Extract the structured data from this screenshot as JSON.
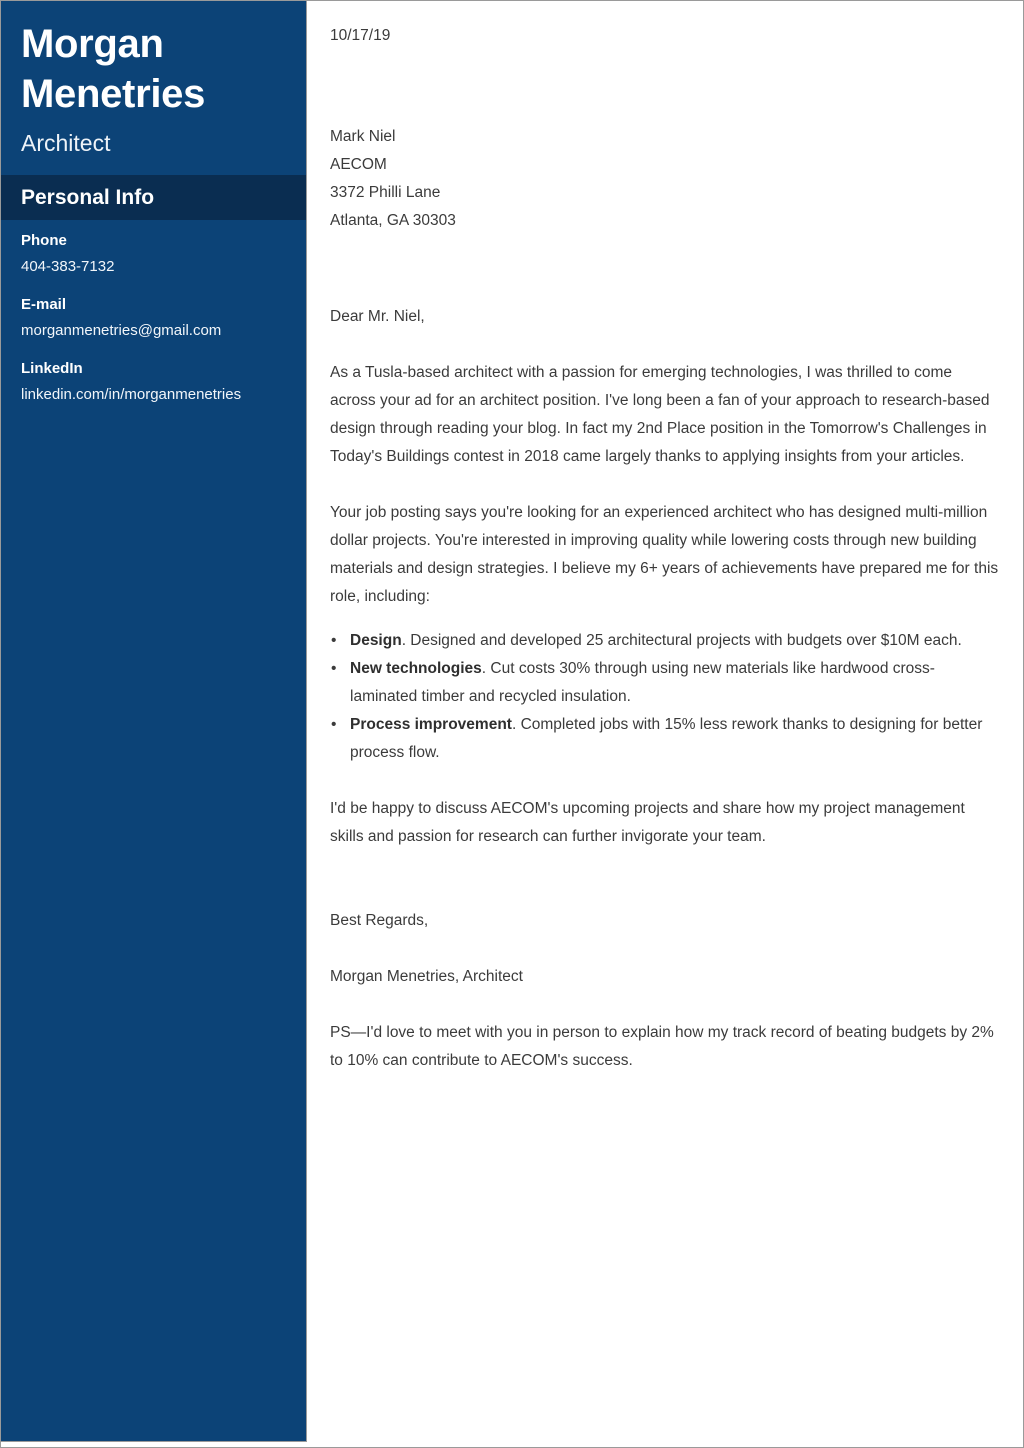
{
  "document": {
    "type": "cover-letter",
    "accent_color": "#0c4377",
    "band_color": "#0a2d51",
    "body_text_color": "#3b3b3b",
    "page_border_color": "#9a9a9a"
  },
  "sidebar": {
    "full_name": "Morgan\nMenetries",
    "job_title": "Architect",
    "section_title": "Personal Info",
    "contacts": [
      {
        "label": "Phone",
        "value": "404-383-7132"
      },
      {
        "label": "E-mail",
        "value": "morganmenetries@gmail.com"
      },
      {
        "label": "LinkedIn",
        "value": "linkedin.com/in/morganmenetries"
      }
    ]
  },
  "letter": {
    "date": "10/17/19",
    "recipient": [
      "Mark Niel",
      "AECOM",
      "3372 Philli Lane",
      "Atlanta, GA 30303"
    ],
    "salutation": "Dear Mr. Niel,",
    "paragraph_1": "As a Tusla-based architect with a passion for emerging technologies, I was thrilled to come across your ad for an architect position. I've long been a fan of your approach to research-based design through reading your blog. In fact my 2nd Place position in the Tomorrow's Challenges in Today's Buildings contest in 2018 came largely thanks to applying insights from your articles.",
    "paragraph_2": "Your job posting says you're looking for an experienced architect who has designed multi-million dollar projects. You're interested in improving quality while lowering costs through new building materials and design strategies. I believe my 6+ years of achievements have prepared me for this role, including:",
    "bullet_marker": "•",
    "bullets": [
      {
        "lead": "Design",
        "text": ". Designed and developed 25 architectural projects with budgets over $10M each."
      },
      {
        "lead": "New technologies",
        "text": ". Cut costs 30% through using new materials like hardwood cross-laminated timber and recycled insulation."
      },
      {
        "lead": "Process improvement",
        "text": ". Completed jobs with 15% less rework thanks to designing for better process flow."
      }
    ],
    "paragraph_3": "I'd be happy to discuss AECOM's upcoming projects and share how my project management skills and passion for research can further invigorate your team.",
    "closing": "Best Regards,",
    "signature": "Morgan Menetries, Architect",
    "postscript": "PS—I'd love to meet with you in person to explain how my track record of beating budgets by 2% to 10% can contribute to AECOM's success."
  }
}
